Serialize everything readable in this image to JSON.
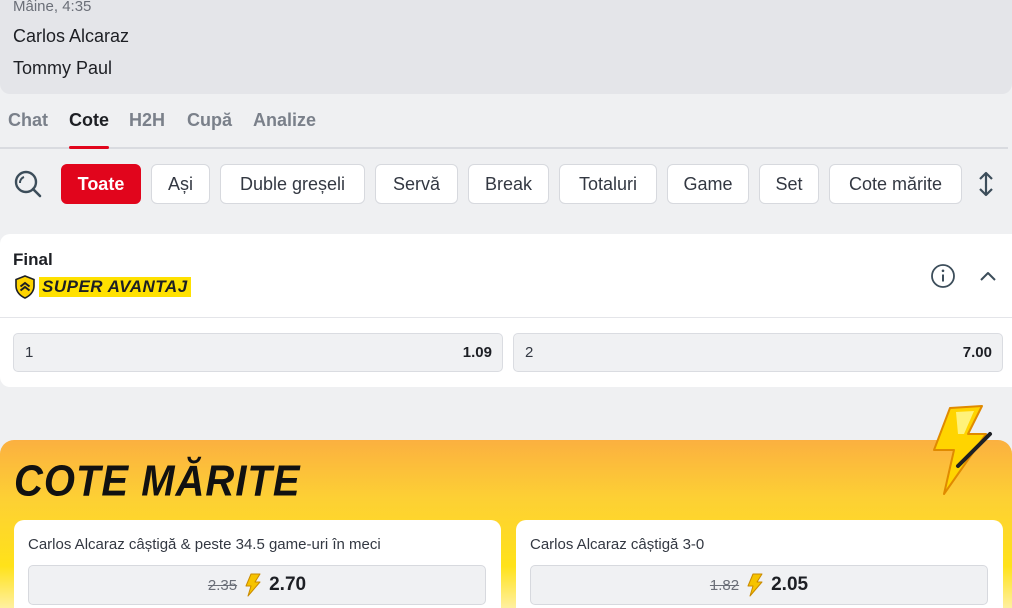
{
  "match": {
    "time": "Mâine, 4:35",
    "player1": "Carlos Alcaraz",
    "player2": "Tommy Paul"
  },
  "tabs": [
    "Chat",
    "Cote",
    "H2H",
    "Cupă",
    "Analize"
  ],
  "active_tab": "Cote",
  "filters": {
    "search_icon": "search-icon",
    "chips": [
      "Toate",
      "Ași",
      "Duble greșeli",
      "Servă",
      "Break",
      "Totaluri",
      "Game",
      "Set",
      "Cote mărite"
    ],
    "active": "Toate",
    "sort_icon": "sort-arrows-icon"
  },
  "market": {
    "title": "Final",
    "badge": "SUPER AVANTAJ",
    "badge_icon": "shield-chevron-icon",
    "info_icon": "info-icon",
    "collapse_icon": "chevron-up-icon",
    "outcomes": [
      {
        "label": "1",
        "odd": "1.09"
      },
      {
        "label": "2",
        "odd": "7.00"
      }
    ]
  },
  "boost": {
    "title": "COTE MĂRITE",
    "icon": "lightning-bolt-icon",
    "cards": [
      {
        "title": "Carlos Alcaraz câștigă & peste 34.5 game-uri în meci",
        "old_odd": "2.35",
        "new_odd": "2.70"
      },
      {
        "title": "Carlos Alcaraz câștigă 3-0",
        "old_odd": "1.82",
        "new_odd": "2.05"
      }
    ]
  },
  "colors": {
    "accent_red": "#e1051c",
    "badge_yellow": "#ffe100",
    "boost_orange": "#fbb040",
    "boost_yellow": "#ffe21a"
  }
}
